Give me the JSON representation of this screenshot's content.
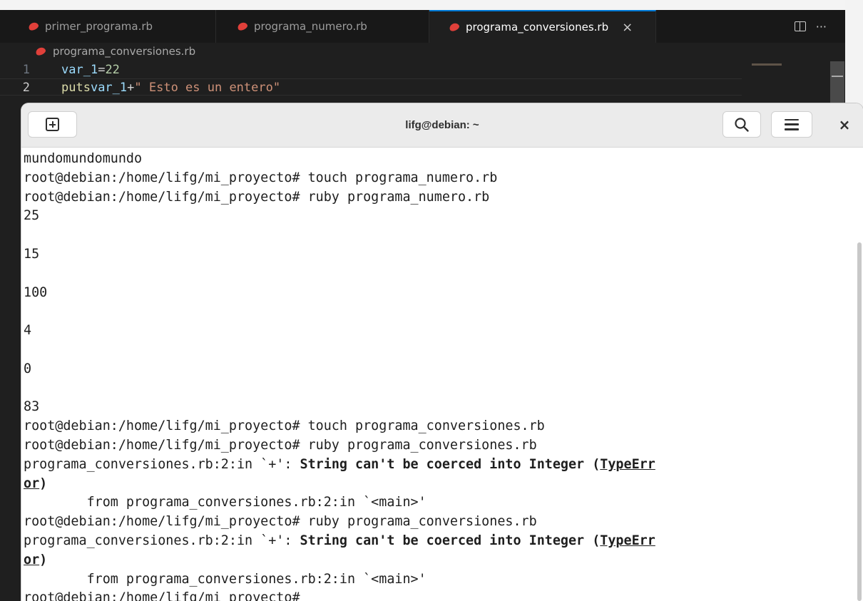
{
  "editor": {
    "tabs": [
      {
        "label": "primer_programa.rb",
        "active": false
      },
      {
        "label": "programa_numero.rb",
        "active": false
      },
      {
        "label": "programa_conversiones.rb",
        "active": true,
        "close": "×"
      }
    ],
    "actions": {
      "more": "···"
    },
    "breadcrumb": "programa_conversiones.rb",
    "lines": [
      {
        "n": "1",
        "var": "var_1",
        "op": " =",
        "num": "22"
      },
      {
        "n": "2",
        "fn": "puts",
        "var": " var_1",
        "op": "+",
        "str": "\" Esto es un entero\""
      }
    ]
  },
  "terminal": {
    "title": "lifg@debian: ~",
    "close": "×",
    "lines": [
      "mundomundomundo",
      "root@debian:/home/lifg/mi_proyecto# touch programa_numero.rb",
      "root@debian:/home/lifg/mi_proyecto# ruby programa_numero.rb",
      "25",
      "",
      "15",
      "",
      "100",
      "",
      "4",
      "",
      "0",
      "",
      "83",
      "root@debian:/home/lifg/mi_proyecto# touch programa_conversiones.rb",
      "root@debian:/home/lifg/mi_proyecto# ruby programa_conversiones.rb"
    ],
    "error1": {
      "prefix": "programa_conversiones.rb:2:in `+': ",
      "message": "String can't be coerced into Integer (",
      "type_a": "TypeErr",
      "type_b": "or",
      "close": ")",
      "from": "        from programa_conversiones.rb:2:in `<main>'"
    },
    "cmd_again": "root@debian:/home/lifg/mi_proyecto# ruby programa_conversiones.rb",
    "error2": {
      "prefix": "programa_conversiones.rb:2:in `+': ",
      "message": "String can't be coerced into Integer (",
      "type_a": "TypeErr",
      "type_b": "or",
      "close": ")",
      "from": "        from programa_conversiones.rb:2:in `<main>'"
    },
    "prompt": "root@debian:/home/lifg/mi_proyecto# "
  }
}
